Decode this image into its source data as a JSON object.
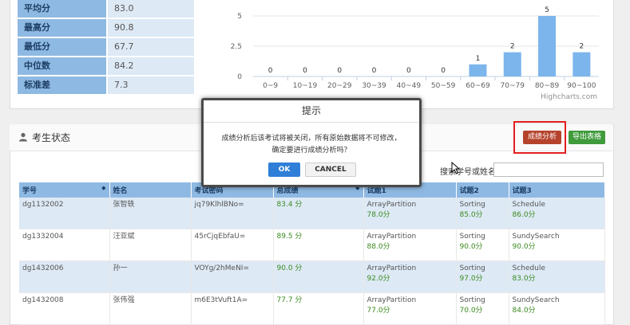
{
  "stats": [
    {
      "label": "平均分",
      "value": "83.0"
    },
    {
      "label": "最高分",
      "value": "90.8"
    },
    {
      "label": "最低分",
      "value": "67.7"
    },
    {
      "label": "中位数",
      "value": "84.2"
    },
    {
      "label": "标准差",
      "value": "7.3"
    }
  ],
  "chart_data": {
    "type": "bar",
    "categories": [
      "0~9",
      "10~19",
      "20~29",
      "30~39",
      "40~49",
      "50~59",
      "60~69",
      "70~79",
      "80~89",
      "90~100"
    ],
    "values": [
      0,
      0,
      0,
      0,
      0,
      0,
      1,
      2,
      5,
      2
    ],
    "yticks": [
      "5",
      "2.5",
      "0"
    ],
    "ylim": [
      0,
      5
    ],
    "credit": "Highcharts.com",
    "bar_color": "#7cb5ec"
  },
  "status_panel": {
    "title": "考生状态",
    "analyze_button": "成绩分析",
    "export_button": "导出表格",
    "search_label": "搜索学号或姓名",
    "search_value": ""
  },
  "table": {
    "headers": [
      "学号",
      "姓名",
      "考试密码",
      "总成绩",
      "试题1",
      "试题2",
      "试题3"
    ],
    "rows": [
      {
        "id": "dg1132002",
        "name": "张智轶",
        "pwd": "jq79KlhlBNo=",
        "total": "83.4 分",
        "q1": "ArrayPartition",
        "q1s": "78.0分",
        "q2": "Sorting",
        "q2s": "85.0分",
        "q3": "Schedule",
        "q3s": "86.0分"
      },
      {
        "id": "dg1332004",
        "name": "汪亚斌",
        "pwd": "45rCjqEbfaU=",
        "total": "89.5 分",
        "q1": "ArrayPartition",
        "q1s": "88.0分",
        "q2": "Sorting",
        "q2s": "90.0分",
        "q3": "SundySearch",
        "q3s": "90.0分"
      },
      {
        "id": "dg1432006",
        "name": "孙一",
        "pwd": "VOYg/2hMeNI=",
        "total": "90.0 分",
        "q1": "ArrayPartition",
        "q1s": "92.0分",
        "q2": "Sorting",
        "q2s": "97.0分",
        "q3": "Schedule",
        "q3s": "83.0分"
      },
      {
        "id": "dg1432008",
        "name": "张伟强",
        "pwd": "m6E3tVuft1A=",
        "total": "77.7 分",
        "q1": "ArrayPartition",
        "q1s": "77.0分",
        "q2": "Sorting",
        "q2s": "70.0分",
        "q3": "SundySearch",
        "q3s": "84.0分"
      }
    ]
  },
  "dialog": {
    "title": "提示",
    "message_line1": "成绩分析后该考试将被关闭，所有原始数据将不可修改，",
    "message_line2": "确定要进行成绩分析吗？",
    "ok_label": "OK",
    "cancel_label": "CANCEL"
  },
  "icons": {
    "user": "user-icon",
    "sort": "sort-icon",
    "cursor": "mouse-cursor-icon"
  }
}
